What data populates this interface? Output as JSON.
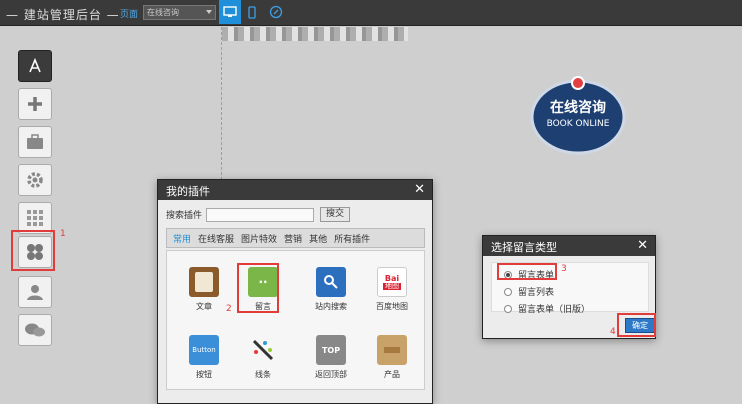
{
  "topbar": {
    "brand": "— 建站管理后台 —",
    "page_label": "页面",
    "page_select_value": "在线咨询",
    "devices": [
      "desktop-icon",
      "mobile-icon",
      "refresh-icon"
    ]
  },
  "badge": {
    "line1": "在线咨询",
    "line2": "BOOK ONLINE"
  },
  "sidebar": {
    "items": [
      "app-store-icon",
      "plus-icon",
      "briefcase-icon",
      "gear-icon",
      "grid-icon",
      "plugin-icon",
      "user-icon",
      "wechat-icon"
    ]
  },
  "markers": {
    "m1": "1",
    "m2": "2",
    "m3": "3",
    "m4": "4"
  },
  "plugins_window": {
    "title": "我的插件",
    "search_label": "搜索插件",
    "search_button": "搜交",
    "tabs": [
      "常用",
      "在线客服",
      "图片特效",
      "营销",
      "其他",
      "所有插件"
    ],
    "items": [
      {
        "label": "文章",
        "icon": "clipboard-icon"
      },
      {
        "label": "留言",
        "icon": "message-icon"
      },
      {
        "label": "站内搜索",
        "icon": "search-icon"
      },
      {
        "label": "百度地图",
        "icon": "baidu-map-icon"
      },
      {
        "label": "按钮",
        "icon": "button-icon"
      },
      {
        "label": "线条",
        "icon": "line-tool-icon"
      },
      {
        "label": "返回顶部",
        "icon": "back-to-top-icon"
      },
      {
        "label": "产品",
        "icon": "product-box-icon"
      }
    ],
    "button_icon_text": "Button",
    "top_icon_text": "TOP",
    "baidu_text": "Bai",
    "map_text": "地图"
  },
  "type_dialog": {
    "title": "选择留言类型",
    "options": [
      "留言表单",
      "留言列表",
      "留言表单（旧版）"
    ],
    "selected_index": 0,
    "confirm_label": "确定"
  }
}
